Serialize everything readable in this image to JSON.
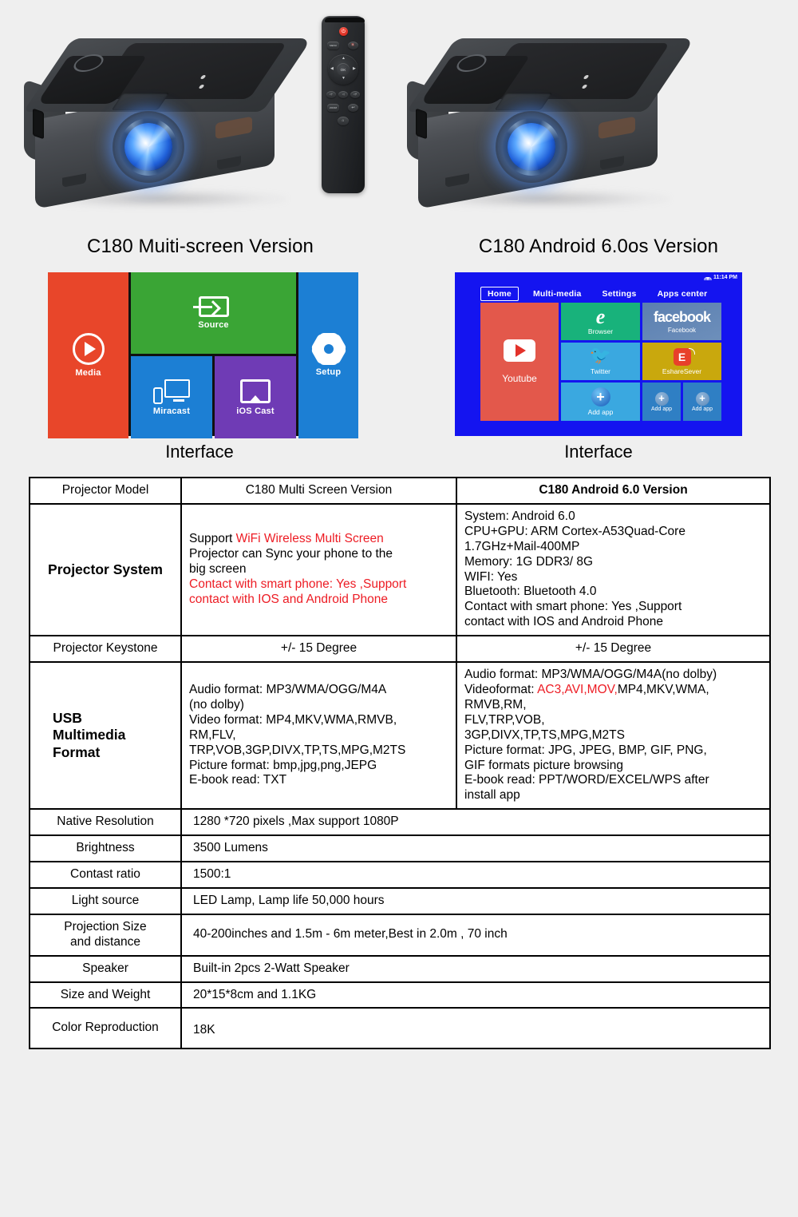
{
  "products": [
    {
      "title": "C180 Muiti-screen Version",
      "interface_label": "Interface",
      "photo_name": "projector-multiscreen-photo",
      "remote_name": "remote-multiscreen"
    },
    {
      "title": "C180 Android 6.0os Version",
      "interface_label": "Interface",
      "photo_name": "projector-android-photo",
      "remote_name": "remote-android-air-mouse"
    }
  ],
  "metro_ui": {
    "tiles": [
      {
        "id": "media",
        "label": "Media",
        "icon": "play-circle-icon",
        "color": "#e8462a"
      },
      {
        "id": "source",
        "label": "Source",
        "icon": "source-input-icon",
        "color": "#3aa535"
      },
      {
        "id": "miracast",
        "label": "Miracast",
        "icon": "miracast-icon",
        "color": "#1c7fd4"
      },
      {
        "id": "ioscast",
        "label": "iOS Cast",
        "icon": "ios-cast-icon",
        "color": "#6f3bb5"
      },
      {
        "id": "setup",
        "label": "Setup",
        "icon": "gear-icon",
        "color": "#1c7fd4"
      }
    ]
  },
  "android_ui": {
    "status": {
      "time": "11:14 PM",
      "wifi_icon": "wifi-icon"
    },
    "nav": [
      {
        "label": "Home",
        "active": true
      },
      {
        "label": "Multi-media",
        "active": false
      },
      {
        "label": "Settings",
        "active": false
      },
      {
        "label": "Apps center",
        "active": false
      }
    ],
    "apps": [
      {
        "id": "youtube",
        "label": "Youtube",
        "icon": "youtube-icon",
        "color": "#e3584b"
      },
      {
        "id": "browser",
        "label": "Browser",
        "icon": "browser-e-icon",
        "color": "#18b27b"
      },
      {
        "id": "facebook",
        "label": "Facebook",
        "icon": "facebook-wordmark-icon",
        "wordmark": "facebook",
        "color": "#5b7fb0"
      },
      {
        "id": "twitter",
        "label": "Twitter",
        "icon": "twitter-bird-icon",
        "color": "#3aa8e0"
      },
      {
        "id": "eshare",
        "label": "EshareSever",
        "icon": "eshare-icon",
        "color": "#c9a80d"
      },
      {
        "id": "addapp1",
        "label": "Add app",
        "icon": "plus-circle-icon",
        "color": "#3aa8e0"
      },
      {
        "id": "addapp2",
        "label": "Add app",
        "icon": "plus-circle-icon",
        "color": "#2f7fc4"
      },
      {
        "id": "addapp3",
        "label": "Add app",
        "icon": "plus-circle-icon",
        "color": "#2f7fc4"
      }
    ]
  },
  "colors": {
    "red": "#ed1c24",
    "page_bg": "#efefef",
    "table_border": "#000000"
  },
  "table": {
    "header": {
      "label": "Projector Model",
      "col_multi": "C180 Multi Screen Version",
      "col_android": "C180 Android 6.0 Version"
    },
    "system": {
      "label": "Projector System",
      "multi": {
        "l1a": "Support ",
        "l1b": "WiFi Wireless Multi Screen",
        "l2": "Projector can Sync your phone to the",
        "l3": "big screen",
        "l4": "Contact with smart phone: Yes ,Support",
        "l5": "contact with IOS and Android Phone"
      },
      "android": {
        "l1": "System: Android 6.0",
        "l2": "CPU+GPU: ARM Cortex-A53Quad-Core",
        "l3": "1.7GHz+Mail-400MP",
        "l4": "Memory: 1G DDR3/ 8G",
        "l5": "WIFI: Yes",
        "l6": "Bluetooth: Bluetooth 4.0",
        "l7": "Contact with smart phone: Yes ,Support",
        "l8": "contact with IOS and Android Phone"
      }
    },
    "keystone": {
      "label": "Projector Keystone",
      "multi": "+/- 15 Degree",
      "android": "+/- 15 Degree"
    },
    "usb": {
      "label_l1": "USB",
      "label_l2": "Multimedia",
      "label_l3": "Format",
      "multi": {
        "l1": "Audio format: MP3/WMA/OGG/M4A",
        "l2": "(no dolby)",
        "l3": "Video format: MP4,MKV,WMA,RMVB,",
        "l4": "RM,FLV,",
        "l5": "TRP,VOB,3GP,DIVX,TP,TS,MPG,M2TS",
        "l6": "Picture format: bmp,jpg,png,JEPG",
        "l7": "E-book read: TXT"
      },
      "android": {
        "l1": "Audio format: MP3/WMA/OGG/M4A(no dolby)",
        "l2a": "Videoformat: ",
        "l2b": "AC3,AVI,MOV,",
        "l2c": "MP4,MKV,WMA,",
        "l3": "RMVB,RM,",
        "l4": "FLV,TRP,VOB,",
        "l5": "3GP,DIVX,TP,TS,MPG,M2TS",
        "l6": "Picture format: JPG, JPEG, BMP, GIF, PNG,",
        "l7": "GIF formats picture browsing",
        "l8": "E-book read: PPT/WORD/EXCEL/WPS after",
        "l9": "install app"
      }
    },
    "rows": [
      {
        "label": "Native Resolution",
        "value": "1280 *720 pixels ,Max support 1080P",
        "red": true
      },
      {
        "label": "Brightness",
        "value": "3500 Lumens",
        "red": true
      },
      {
        "label": "Contast ratio",
        "value": "1500:1",
        "red": false
      },
      {
        "label": "Light source",
        "value": "LED Lamp, Lamp life 50,000 hours",
        "red": true
      },
      {
        "label": "Projection Size and distance",
        "label_l1": "Projection Size",
        "label_l2": "and distance",
        "value": "40-200inches and 1.5m - 6m meter,Best in 2.0m , 70 inch",
        "red": false
      },
      {
        "label": "Speaker",
        "value": "Built-in 2pcs 2-Watt Speaker",
        "red": false
      },
      {
        "label": "Size and Weight",
        "value": "20*15*8cm and  1.1KG",
        "red": false
      },
      {
        "label": "Color Reproduction",
        "value": "18K",
        "red": false
      }
    ]
  }
}
